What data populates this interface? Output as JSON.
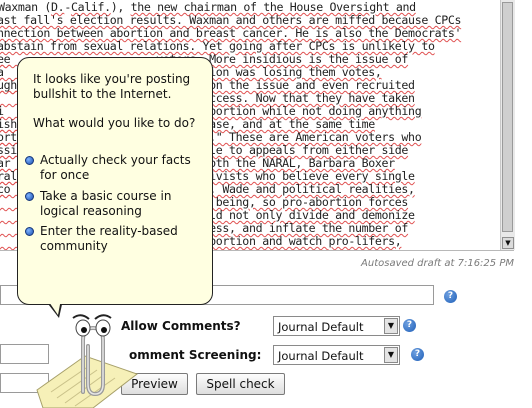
{
  "editor": {
    "lines": [
      [
        {
          "t": "Waxman ("
        },
        {
          "t": "D.",
          "s": 1
        },
        {
          "t": "-"
        },
        {
          "t": "Calif.",
          "s": 1
        },
        {
          "t": "), "
        },
        {
          "t": "the new chairman of the House Oversight and",
          "s": 1
        }
      ],
      [
        {
          "t": "ast fall's election results. Waxman and others are miffed because CPCs",
          "s": 1
        }
      ],
      [
        {
          "t": "nnection between abortion and breast cancer. He is also the Democrats'",
          "s": 1
        }
      ],
      [
        {
          "t": "abstain from sexual relations. Yet going after CPCs is unlikely to",
          "s": 1
        }
      ],
      [
        {
          "t": "                        voters. More insidious is the issue of",
          "s": 1
        }
      ],
      [
        {
          "t": "                        of abortion was losing them votes,",
          "s": 1
        }
      ],
      [
        {
          "t": "                        oderate on the issue and even recruited",
          "s": 1
        }
      ],
      [
        {
          "t": "                        rable success. Now that they have taken",
          "s": 1
        }
      ],
      [
        {
          "t": "                        ducing abortion while not doing anything",
          "s": 1
        }
      ],
      [
        {
          "t": "                        -death base, and at the same time",
          "s": 1
        }
      ],
      [
        {
          "t": "                        on grays.\" These are American voters who",
          "s": 1
        }
      ],
      [
        {
          "t": "                        usceptible to appeals from either side",
          "s": 1
        }
      ],
      [
        {
          "t": "                        remist both the NARAL, Barbara Boxer",
          "s": 1
        }
      ],
      [
        {
          "t": "                        tion activists who believe every single",
          "s": 1
        }
      ],
      [
        {
          "t": "                        of Roe v. Wade and political realities,",
          "s": 1
        }
      ],
      [
        {
          "t": "                        the time being, so pro-abortion forces",
          "s": 1
        }
      ],
      [
        {
          "t": "                        each could not only divide and demonize",
          "s": 1
        }
      ],
      [
        {
          "t": "                        ic distress, and inflate the number of",
          "s": 1
        }
      ],
      [
        {
          "t": "                        ducing abortion and watch pro-lifers,",
          "s": 1
        }
      ]
    ],
    "left_fragments": [
      {
        "row": 4,
        "text": "ee"
      },
      {
        "row": 5,
        "text": "a"
      },
      {
        "row": 6,
        "text": "ugh"
      },
      {
        "row": 8,
        "text": "i"
      },
      {
        "row": 9,
        "text": "ish"
      },
      {
        "row": 10,
        "text": "ort"
      },
      {
        "row": 11,
        "text": "ssi"
      },
      {
        "row": 12,
        "text": "ar"
      },
      {
        "row": 13,
        "text": "ral"
      },
      {
        "row": 14,
        "text": "co"
      }
    ]
  },
  "autosave": "Autosaved draft at 7:16:25 PM",
  "form": {
    "allow_comments_label": "Allow Comments?",
    "allow_comments_value": "Journal Default",
    "comment_screening_label": "omment Screening:",
    "comment_screening_value": "Journal Default",
    "preview_label": "Preview",
    "spellcheck_label": "Spell check"
  },
  "clippy": {
    "message": "It looks like you're posting bullshit to the Internet.",
    "question": "What would you like to do?",
    "options": [
      "Actually check your facts for once",
      "Take a basic course in logical reasoning",
      "Enter the reality-based community"
    ]
  },
  "icons": {
    "help": "help-icon",
    "dropdown": "dropdown-arrow-icon",
    "option_bullet": "option-bullet-icon",
    "assistant": "paperclip-assistant-icon"
  },
  "colors": {
    "bubble_bg": "#ffffe1",
    "spellcheck_underline": "#e05050",
    "help_blue": "#1f5fb8"
  }
}
